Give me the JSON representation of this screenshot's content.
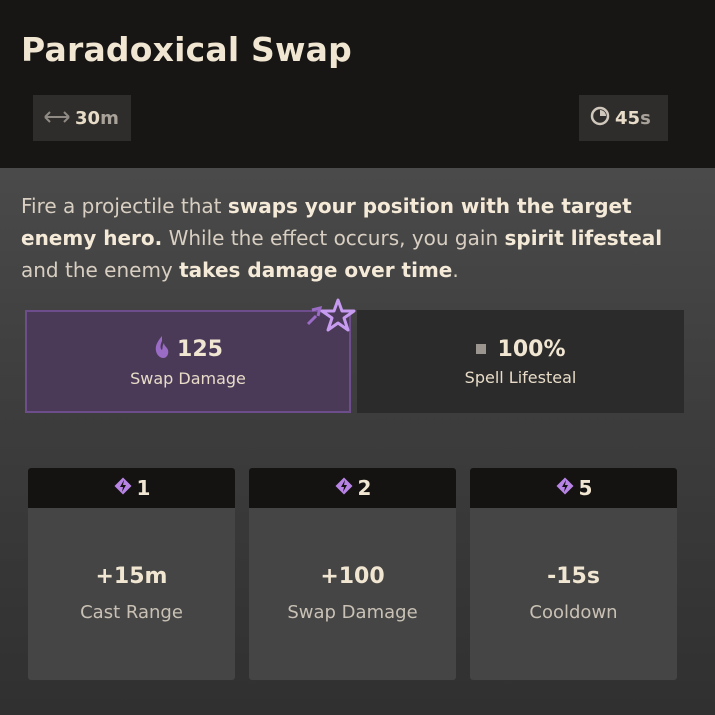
{
  "ability": {
    "title": "Paradoxical Swap",
    "range": {
      "value": "30",
      "unit": "m"
    },
    "cooldown": {
      "value": "45",
      "unit": "s"
    }
  },
  "description": {
    "p1": "Fire a projectile that ",
    "b1": "swaps your position with the target enemy hero.",
    "p2": " While the effect occurs, you gain ",
    "b2": "spirit lifesteal",
    "p3": " and the enemy ",
    "b3": "takes damage over time",
    "p4": "."
  },
  "properties": [
    {
      "value": "125",
      "label": "Swap Damage",
      "icon": "spirit-flame-icon",
      "accent": "#6d4d8c"
    },
    {
      "value": "100%",
      "label": "Spell Lifesteal",
      "icon": "square-icon"
    }
  ],
  "upgrades": [
    {
      "cost": "1",
      "value": "+15m",
      "label": "Cast Range",
      "icon": "ability-point-icon"
    },
    {
      "cost": "2",
      "value": "+100",
      "label": "Swap Damage",
      "icon": "ability-point-icon"
    },
    {
      "cost": "5",
      "value": "-15s",
      "label": "Cooldown",
      "icon": "ability-point-icon"
    }
  ],
  "colors": {
    "spirit": "#9b6cc5",
    "header_bg": "#171614",
    "panel_bg": "#454545"
  }
}
